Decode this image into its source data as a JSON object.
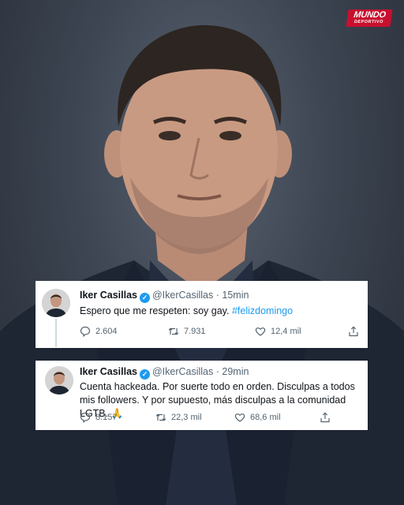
{
  "brand": {
    "logo_main": "MUNDO",
    "logo_sub": "DEPORTIVO",
    "color": "#c8102e"
  },
  "tweets": [
    {
      "name": "Iker Casillas",
      "handle": "@IkerCasillas",
      "separator": "·",
      "time": "15min",
      "text": "Espero que me respeten: soy gay.",
      "hashtag": "#felizdomingo",
      "replies": "2.604",
      "retweets": "7.931",
      "likes": "12,4 mil"
    },
    {
      "name": "Iker Casillas",
      "handle": "@IkerCasillas",
      "separator": "·",
      "time": "29min",
      "text": "Cuenta hackeada. Por suerte todo en orden. Disculpas a todos mis followers. Y por supuesto, más disculpas a la comunidad LGTB.",
      "emoji": "🙏",
      "replies": "8.157",
      "retweets": "22,3 mil",
      "likes": "68,6 mil"
    }
  ],
  "icons": [
    "verified-icon",
    "reply-icon",
    "retweet-icon",
    "like-icon",
    "share-icon"
  ],
  "colors": {
    "link": "#1d9bf0",
    "muted": "#536471",
    "text": "#0f1419"
  }
}
